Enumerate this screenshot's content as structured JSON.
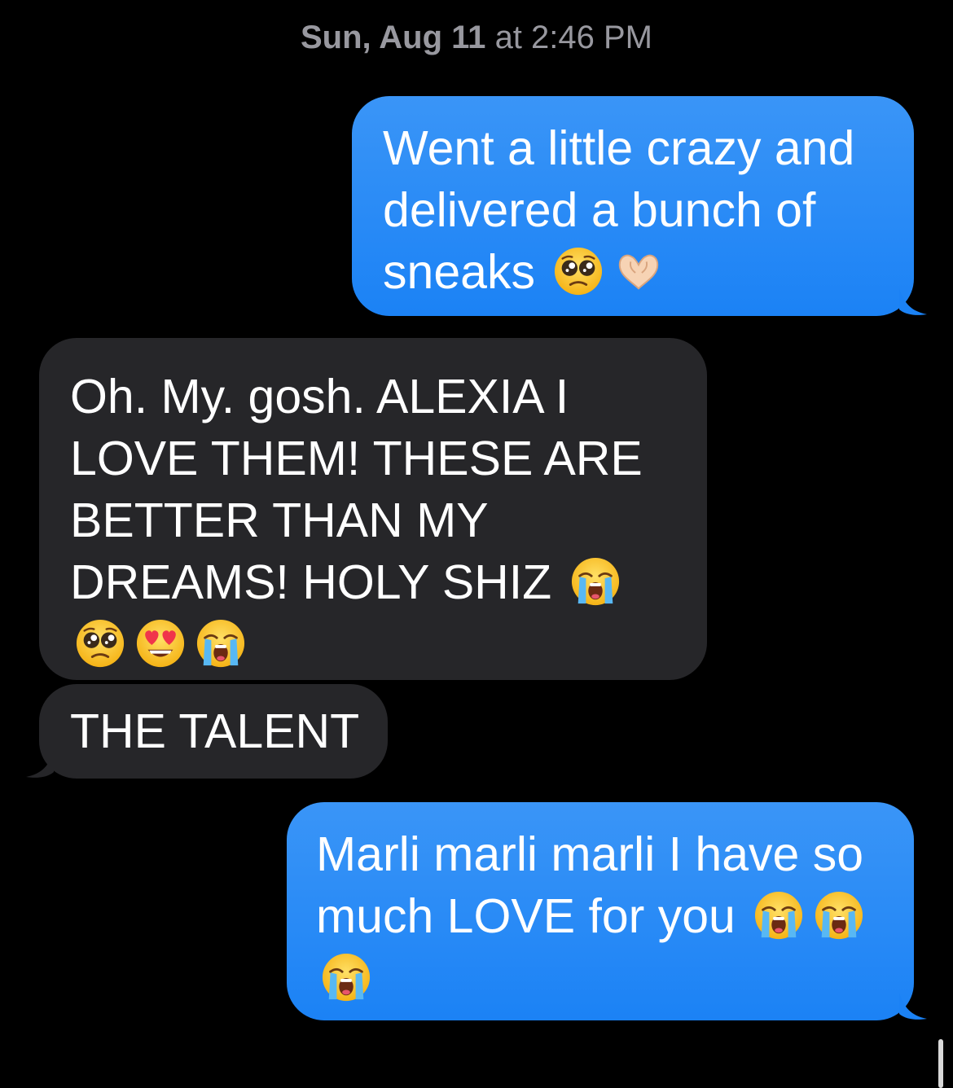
{
  "conversation": {
    "timestamp_day": "Sun, Aug 11",
    "timestamp_time": "at 2:46 PM",
    "colors": {
      "outgoing_bubble": "#1b82f5",
      "incoming_bubble": "#262629",
      "background": "#000000",
      "timestamp_text": "#98989f"
    },
    "messages": [
      {
        "direction": "outgoing",
        "text": "Went a little crazy and delivered a bunch of sneaks",
        "emojis": [
          "pleading-face-emoji",
          "heart-hands-emoji"
        ]
      },
      {
        "direction": "incoming",
        "text": "Oh. My. gosh. ALEXIA I LOVE THEM! THESE ARE BETTER THAN MY DREAMS! HOLY SHIZ",
        "emojis": [
          "loudly-crying-face-emoji",
          "pleading-face-emoji",
          "heart-eyes-face-emoji",
          "loudly-crying-face-emoji"
        ]
      },
      {
        "direction": "incoming",
        "text": "THE TALENT",
        "emojis": []
      },
      {
        "direction": "outgoing",
        "text": "Marli marli marli I have so much LOVE for you",
        "emojis": [
          "loudly-crying-face-emoji",
          "loudly-crying-face-emoji",
          "loudly-crying-face-emoji"
        ]
      }
    ]
  }
}
